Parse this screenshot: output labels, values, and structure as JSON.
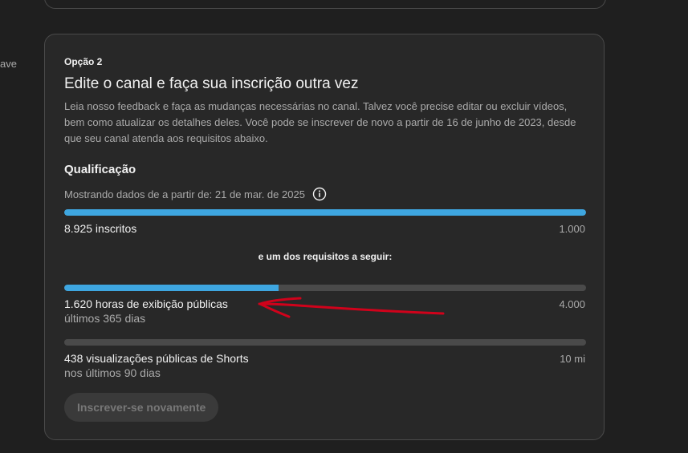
{
  "sidebar_fragment": "ave",
  "option": {
    "label": "Opção 2",
    "title": "Edite o canal e faça sua inscrição outra vez",
    "description": "Leia nosso feedback e faça as mudanças necessárias no canal. Talvez você precise editar ou excluir vídeos, bem como atualizar os detalhes deles. Você pode se inscrever de novo a partir de 16 de junho de 2023, desde que seu canal atenda aos requisitos abaixo."
  },
  "qualification": {
    "title": "Qualificação",
    "data_date": "Mostrando dados de a partir de: 21 de mar. de 2025",
    "info_icon": "info-icon"
  },
  "metrics": {
    "subscribers": {
      "label": "8.925 inscritos",
      "target": "1.000",
      "progress": 1.0
    },
    "requirement_note": "e um dos requisitos a seguir:",
    "watch_hours": {
      "label": "1.620 horas de exibição públicas",
      "sub": "últimos 365 dias",
      "target": "4.000",
      "progress": 0.41
    },
    "shorts_views": {
      "label": "438 visualizações públicas de Shorts",
      "sub": "nos últimos 90 dias",
      "target": "10 mi",
      "progress": 0.0
    }
  },
  "actions": {
    "resubscribe": "Inscrever-se novamente"
  },
  "colors": {
    "progress_fill": "#3ea6e0",
    "progress_track": "#4a4a4a",
    "annotation": "#d0021b"
  }
}
